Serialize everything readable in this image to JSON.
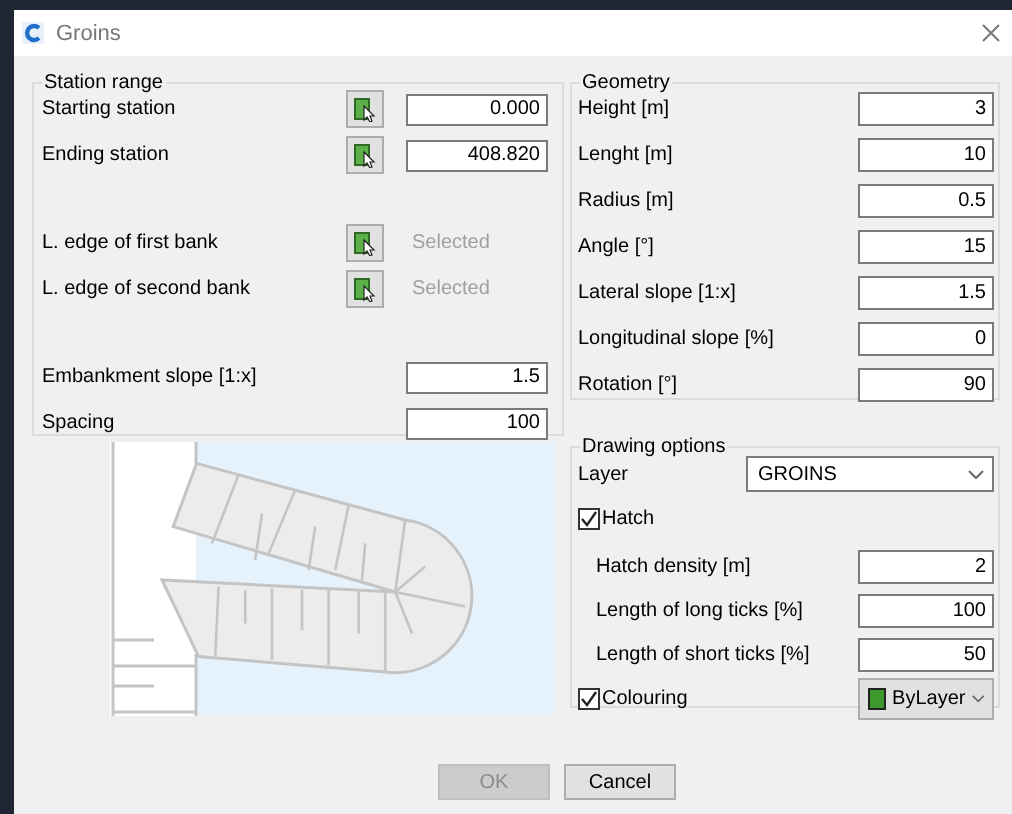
{
  "window": {
    "title": "Groins"
  },
  "station_range": {
    "title": "Station range",
    "sections": [
      [
        {
          "kind": "pick_value",
          "label": "Starting station",
          "value": "0.000"
        },
        {
          "kind": "pick_value",
          "label": "Ending station",
          "value": "408.820"
        }
      ],
      [
        {
          "kind": "pick_status",
          "label": "L. edge of first bank",
          "status": "Selected"
        },
        {
          "kind": "pick_status",
          "label": "L. edge of second bank",
          "status": "Selected"
        }
      ],
      [
        {
          "kind": "value",
          "label": "Embankment slope [1:x]",
          "value": "1.5"
        },
        {
          "kind": "value",
          "label": "Spacing",
          "value": "100"
        }
      ]
    ]
  },
  "geometry": {
    "title": "Geometry",
    "rows": [
      {
        "label": "Height [m]",
        "value": "3"
      },
      {
        "label": "Lenght [m]",
        "value": "10"
      },
      {
        "label": "Radius [m]",
        "value": "0.5"
      },
      {
        "label": "Angle [°]",
        "value": "15"
      },
      {
        "label": "Lateral slope [1:x]",
        "value": "1.5"
      },
      {
        "label": "Longitudinal slope [%]",
        "value": "0"
      },
      {
        "label": "Rotation [°]",
        "value": "90"
      }
    ]
  },
  "drawing_options": {
    "title": "Drawing options",
    "layer": {
      "label": "Layer",
      "value": "GROINS"
    },
    "hatch": {
      "label": "Hatch",
      "checked": true
    },
    "hatch_rows": [
      {
        "label": "Hatch density [m]",
        "value": "2"
      },
      {
        "label": "Length of long ticks [%]",
        "value": "100"
      },
      {
        "label": "Length of short ticks [%]",
        "value": "50"
      }
    ],
    "colouring": {
      "label": "Colouring",
      "checked": true,
      "value": "ByLayer",
      "color": "#3c9a2c"
    }
  },
  "buttons": [
    {
      "label": "OK",
      "disabled": true
    },
    {
      "label": "Cancel",
      "disabled": false
    }
  ]
}
